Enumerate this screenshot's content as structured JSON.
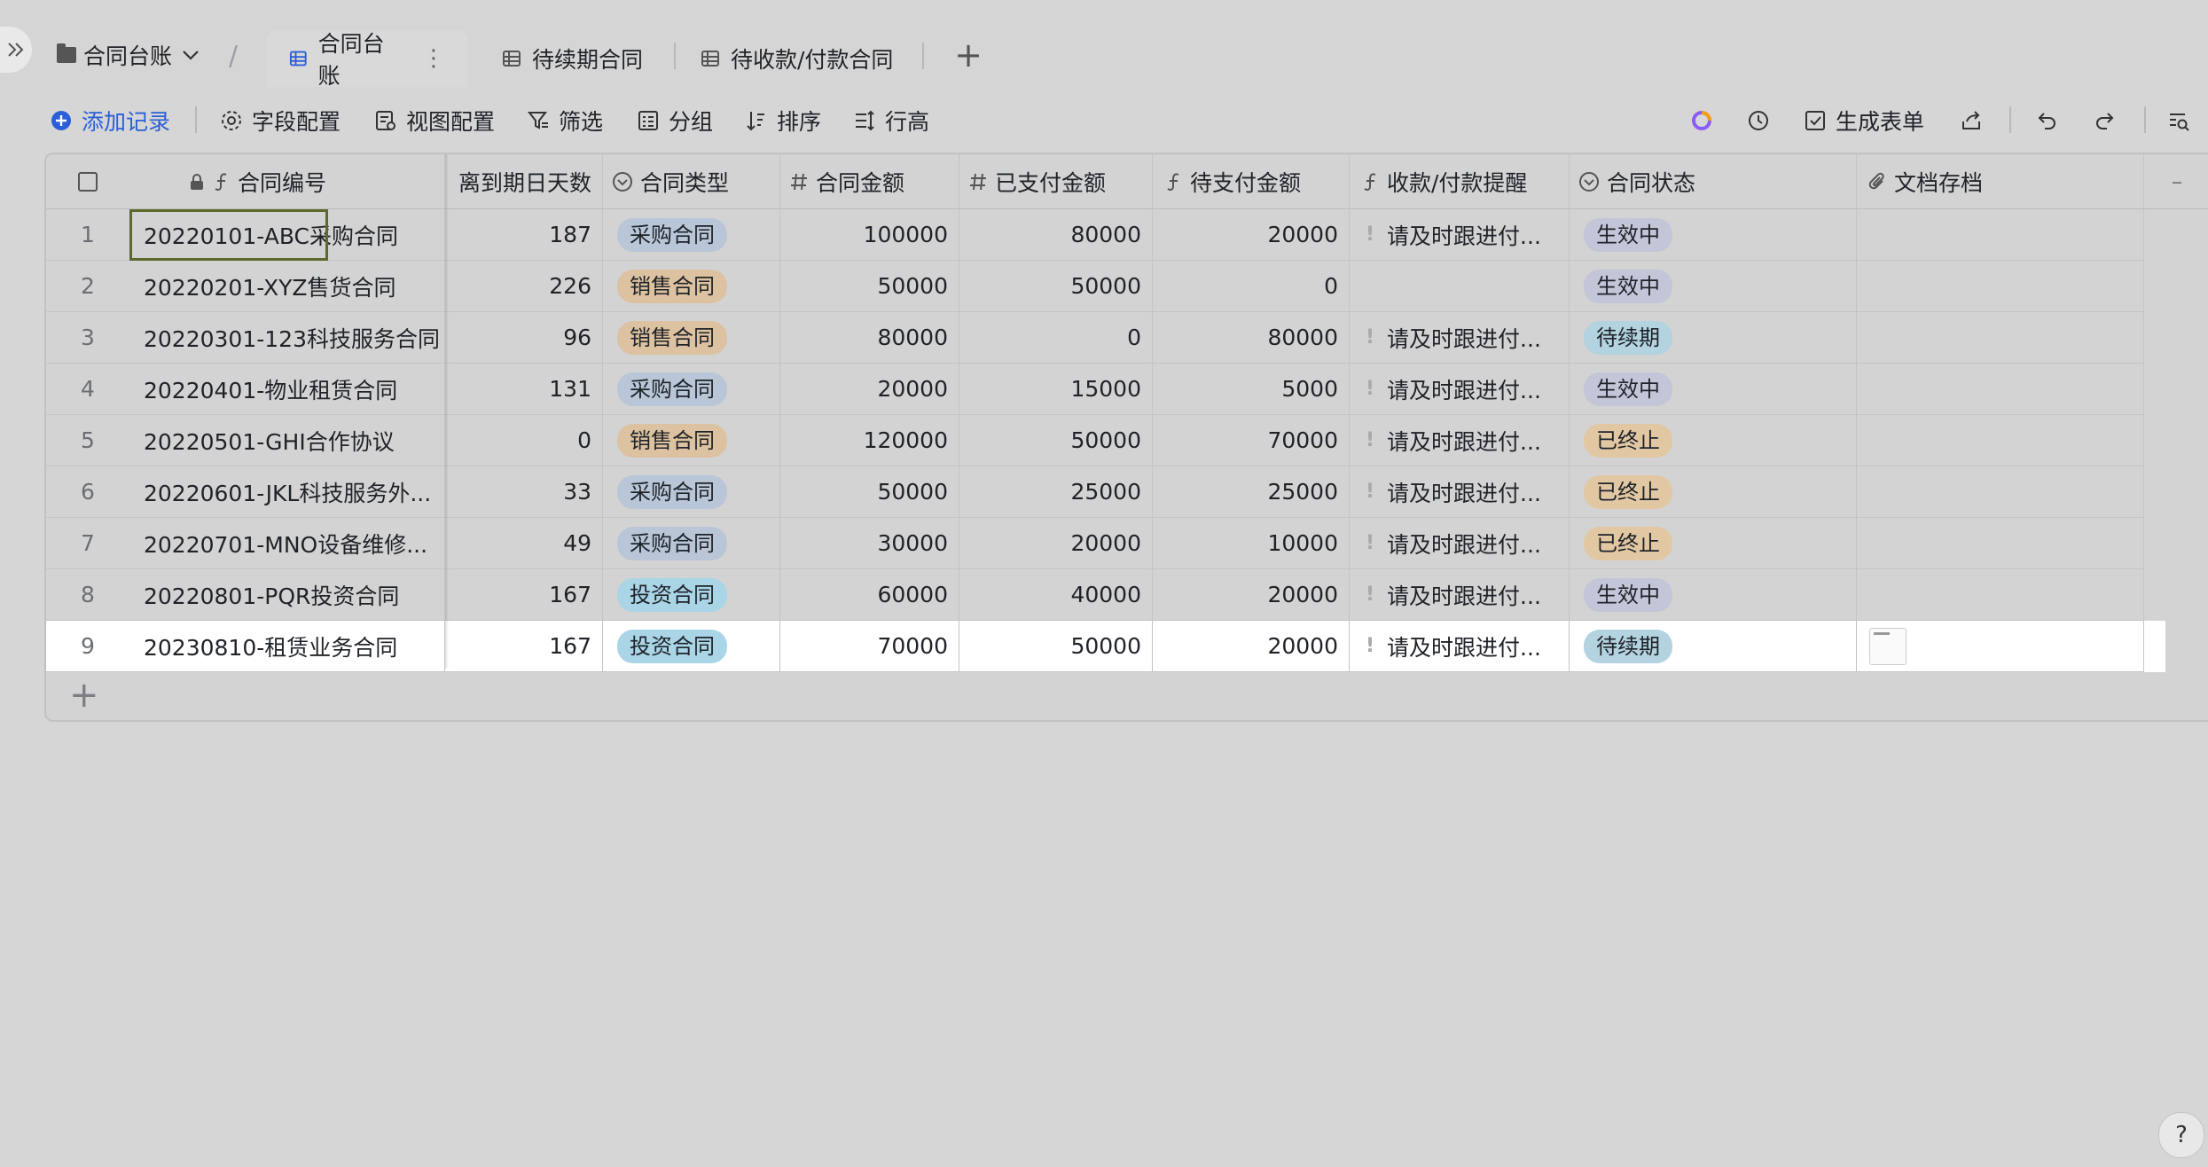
{
  "header": {
    "base_title": "合同台账",
    "tabs": [
      {
        "label": "合同台账"
      },
      {
        "label": "待续期合同"
      },
      {
        "label": "待收款/付款合同"
      }
    ],
    "add_tab": "+"
  },
  "toolbar": {
    "add_record": "添加记录",
    "field_config": "字段配置",
    "view_config": "视图配置",
    "filter": "筛选",
    "group": "分组",
    "sort": "排序",
    "row_height": "行高",
    "generate_form": "生成表单"
  },
  "table": {
    "columns": [
      "合同编号",
      "离到期日天数",
      "合同类型",
      "合同金额",
      "已支付金额",
      "待支付金额",
      "收款/付款提醒",
      "合同状态",
      "文档存档"
    ],
    "rows": [
      {
        "idx": "1",
        "name": "20220101-ABC采购合同",
        "days": "187",
        "type": "采购合同",
        "amount": "100000",
        "paid": "80000",
        "pending": "20000",
        "remind": "请及时跟进付...",
        "status": "生效中"
      },
      {
        "idx": "2",
        "name": "20220201-XYZ售货合同",
        "days": "226",
        "type": "销售合同",
        "amount": "50000",
        "paid": "50000",
        "pending": "0",
        "remind": "",
        "status": "生效中"
      },
      {
        "idx": "3",
        "name": "20220301-123科技服务合同",
        "days": "96",
        "type": "销售合同",
        "amount": "80000",
        "paid": "0",
        "pending": "80000",
        "remind": "请及时跟进付...",
        "status": "待续期"
      },
      {
        "idx": "4",
        "name": "20220401-物业租赁合同",
        "days": "131",
        "type": "采购合同",
        "amount": "20000",
        "paid": "15000",
        "pending": "5000",
        "remind": "请及时跟进付...",
        "status": "生效中"
      },
      {
        "idx": "5",
        "name": "20220501-GHI合作协议",
        "days": "0",
        "type": "销售合同",
        "amount": "120000",
        "paid": "50000",
        "pending": "70000",
        "remind": "请及时跟进付...",
        "status": "已终止"
      },
      {
        "idx": "6",
        "name": "20220601-JKL科技服务外...",
        "days": "33",
        "type": "采购合同",
        "amount": "50000",
        "paid": "25000",
        "pending": "25000",
        "remind": "请及时跟进付...",
        "status": "已终止"
      },
      {
        "idx": "7",
        "name": "20220701-MNO设备维修...",
        "days": "49",
        "type": "采购合同",
        "amount": "30000",
        "paid": "20000",
        "pending": "10000",
        "remind": "请及时跟进付...",
        "status": "已终止"
      },
      {
        "idx": "8",
        "name": "20220801-PQR投资合同",
        "days": "167",
        "type": "投资合同",
        "amount": "60000",
        "paid": "40000",
        "pending": "20000",
        "remind": "请及时跟进付...",
        "status": "生效中"
      },
      {
        "idx": "9",
        "name": "20230810-租赁业务合同",
        "days": "167",
        "type": "投资合同",
        "amount": "70000",
        "paid": "50000",
        "pending": "20000",
        "remind": "请及时跟进付...",
        "status": "待续期"
      }
    ]
  },
  "help": "?"
}
